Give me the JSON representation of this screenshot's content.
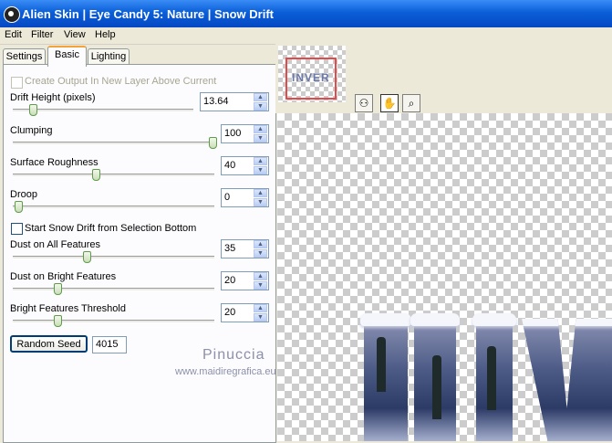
{
  "window": {
    "title": "Alien Skin | Eye Candy 5: Nature | Snow Drift"
  },
  "menu": [
    "Edit",
    "Filter",
    "View",
    "Help"
  ],
  "tabs": [
    "Settings",
    "Basic",
    "Lighting"
  ],
  "active_tab": "Basic",
  "basic": {
    "create_output_label": "Create Output In New Layer Above Current",
    "drift_height": {
      "label": "Drift Height (pixels)",
      "value": "13.64",
      "slider_fraction": 0.07
    },
    "clumping": {
      "label": "Clumping",
      "value": "100",
      "slider_fraction": 1.0
    },
    "surface_roughness": {
      "label": "Surface Roughness",
      "value": "40",
      "slider_fraction": 0.4
    },
    "droop": {
      "label": "Droop",
      "value": "0",
      "slider_fraction": 0.0
    },
    "start_from_selection_label": "Start Snow Drift from Selection Bottom",
    "dust_all": {
      "label": "Dust on All Features",
      "value": "35",
      "slider_fraction": 0.35
    },
    "dust_bright": {
      "label": "Dust on Bright Features",
      "value": "20",
      "slider_fraction": 0.2
    },
    "bright_threshold": {
      "label": "Bright Features Threshold",
      "value": "20",
      "slider_fraction": 0.2
    },
    "random_seed_label": "Random Seed",
    "random_seed_value": "4015"
  },
  "preview": {
    "thumbnail_text": "INVER",
    "tools": [
      "navigator-icon",
      "hand-icon",
      "zoom-icon"
    ]
  },
  "watermark": {
    "name": "Pinuccia",
    "url": "www.maidiregrafica.eu"
  },
  "colors": {
    "titlebar": "#0a5fd8",
    "tab_highlight": "#f4a33a",
    "thumb_frame": "#e04b4b"
  }
}
